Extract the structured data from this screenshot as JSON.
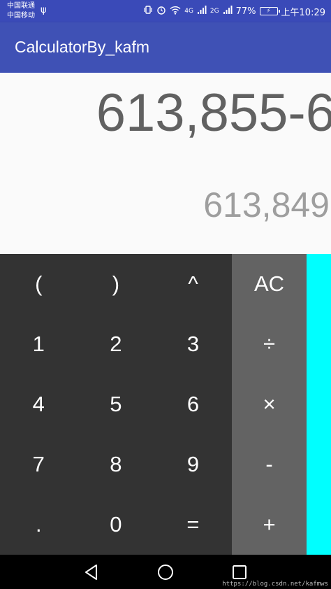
{
  "status_bar": {
    "carrier1": "中国联通",
    "carrier2": "中国移动",
    "network1": "4G",
    "network2": "2G",
    "battery_percent": "77%",
    "time": "上午10:29"
  },
  "app_bar": {
    "title": "CalculatorBy_kafm"
  },
  "display": {
    "formula": "613,855-6",
    "result": "613,849"
  },
  "keypad": {
    "numbers": [
      [
        "(",
        ")",
        "^"
      ],
      [
        "1",
        "2",
        "3"
      ],
      [
        "4",
        "5",
        "6"
      ],
      [
        "7",
        "8",
        "9"
      ],
      [
        ".",
        "0",
        "="
      ]
    ],
    "operators": [
      "AC",
      "÷",
      "×",
      "-",
      "+"
    ]
  },
  "watermark": "https://blog.csdn.net/kafmws",
  "colors": {
    "status_bar": "#3a4ab8",
    "app_bar": "#3f51b5",
    "numpad": "#333333",
    "operators": "#636363",
    "advanced_panel": "#00ffff"
  }
}
